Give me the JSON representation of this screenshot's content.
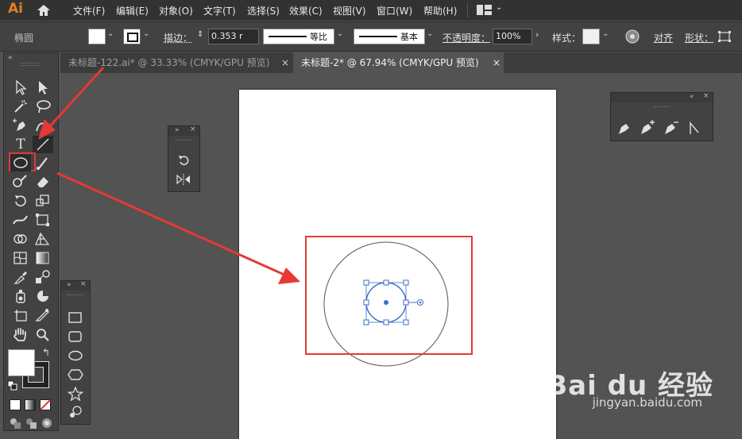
{
  "app": {
    "logo": "Ai",
    "accent": "#e67e22"
  },
  "menu": [
    "文件(F)",
    "编辑(E)",
    "对象(O)",
    "文字(T)",
    "选择(S)",
    "效果(C)",
    "视图(V)",
    "窗口(W)",
    "帮助(H)"
  ],
  "control_bar": {
    "tool_name": "椭圆",
    "stroke_label": "描边：",
    "stroke_value": "0.353 r",
    "stroke_profile": "等比",
    "brush": "基本",
    "opacity_label": "不透明度：",
    "opacity_value": "100%",
    "style_label": "样式：",
    "align_label": "对齐",
    "shape_label": "形状："
  },
  "tabs": [
    {
      "label": "未标题-122.ai* @ 33.33% (CMYK/GPU 预览)",
      "active": false
    },
    {
      "label": "未标题-2* @ 67.94% (CMYK/GPU 预览)",
      "active": true
    }
  ],
  "tab_close": "×",
  "toolbox": {
    "tools": [
      "selection-tool",
      "direct-selection-tool",
      "magic-wand-tool",
      "lasso-tool",
      "pen-tool",
      "curvature-tool",
      "type-tool",
      "line-segment-tool",
      "ellipse-tool",
      "paintbrush-tool",
      "shaper-tool",
      "eraser-tool",
      "rotate-tool",
      "scale-tool",
      "width-tool",
      "free-transform-tool",
      "shape-builder-tool",
      "perspective-grid-tool",
      "mesh-tool",
      "gradient-tool",
      "eyedropper-tool",
      "blend-tool",
      "symbol-sprayer-tool",
      "column-graph-tool",
      "artboard-tool",
      "slice-tool",
      "hand-tool",
      "zoom-tool"
    ],
    "selected_tool": "ellipse-tool"
  },
  "shape_flyout": [
    "rectangle-tool",
    "rounded-rectangle-tool",
    "ellipse-tool",
    "polygon-tool",
    "star-tool",
    "flare-tool"
  ],
  "pen_panel": [
    "pen-tool",
    "add-anchor-point-tool",
    "delete-anchor-point-tool",
    "anchor-point-tool"
  ],
  "rotate_panel": [
    "rotate-tool",
    "reflect-tool"
  ],
  "colors": {
    "highlight": "#e53935",
    "selection": "#3d6bc7"
  },
  "watermark": {
    "brand": "Bai du 经验",
    "url": "jingyan.baidu.com"
  }
}
